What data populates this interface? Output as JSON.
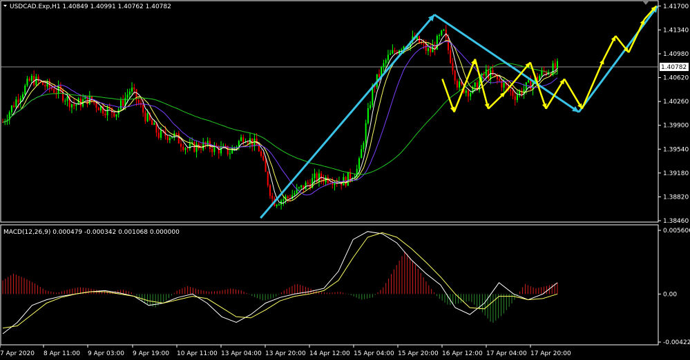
{
  "header": {
    "symbol_line": "USDCAD.Exp,H1  1.40849 1.40991 1.40762 1.40782",
    "macd_line": "MACD(12,26,9) 0.000479 -0.000342 0.001068 0.000000"
  },
  "colors": {
    "background": "#000000",
    "bull": "#00ff00",
    "bear": "#ff0000",
    "ma_fast": "#ffffff",
    "ma_mid": "#ffff66",
    "ma_slow": "#7b3fff",
    "ma_long": "#22cc22",
    "arrow_cyan": "#39c3e6",
    "arrow_yellow": "#ffff00",
    "macd_hist_pos": "#d42020",
    "macd_hist_neg": "#2c8a2c"
  },
  "chart_data": [
    {
      "type": "candlestick",
      "symbol": "USDCAD.Exp",
      "timeframe": "H1",
      "ylim": [
        1.3846,
        1.4175
      ],
      "y_ticks": [
        "1.41700",
        "1.41340",
        "1.40980",
        "1.40620",
        "1.40260",
        "1.39900",
        "1.39540",
        "1.39180",
        "1.38820",
        "1.38460"
      ],
      "current_price": "1.40782",
      "x_ticks": [
        "7 Apr 2020",
        "8 Apr 11:00",
        "9 Apr 03:00",
        "9 Apr 19:00",
        "10 Apr 11:00",
        "13 Apr 04:00",
        "13 Apr 20:00",
        "14 Apr 12:00",
        "15 Apr 04:00",
        "15 Apr 20:00",
        "16 Apr 12:00",
        "17 Apr 04:00",
        "17 Apr 20:00"
      ],
      "price_path": [
        1.3995,
        1.403,
        1.406,
        1.405,
        1.404,
        1.402,
        1.403,
        1.4015,
        1.401,
        1.4045,
        1.4005,
        1.3975,
        1.3975,
        1.3955,
        1.396,
        1.3955,
        1.395,
        1.3975,
        1.3955,
        1.3875,
        1.388,
        1.3895,
        1.391,
        1.391,
        1.3905,
        1.3925,
        1.4045,
        1.409,
        1.411,
        1.412,
        1.41,
        1.413,
        1.405,
        1.404,
        1.407,
        1.4055,
        1.4035,
        1.405,
        1.407,
        1.4078
      ],
      "cyan_arrows": [
        [
          [
            1.385,
            0.395
          ],
          [
            1.4157,
            0.66
          ]
        ],
        [
          [
            1.4157,
            0.66
          ],
          [
            1.401,
            0.88
          ]
        ],
        [
          [
            1.401,
            0.88
          ],
          [
            1.417,
            1.0
          ]
        ]
      ],
      "yellow_path": [
        [
          0.672,
          1.406
        ],
        [
          0.69,
          1.401
        ],
        [
          0.722,
          1.409
        ],
        [
          0.742,
          1.4015
        ],
        [
          0.768,
          1.404
        ],
        [
          0.806,
          1.4085
        ],
        [
          0.83,
          1.4015
        ],
        [
          0.858,
          1.406
        ],
        [
          0.885,
          1.4015
        ],
        [
          0.918,
          1.409
        ],
        [
          0.936,
          1.4125
        ],
        [
          0.956,
          1.41
        ],
        [
          0.98,
          1.415
        ],
        [
          0.998,
          1.417
        ]
      ]
    },
    {
      "type": "histogram",
      "name": "MACD(12,26,9)",
      "ylim": [
        -0.004229,
        0.005606
      ],
      "y_ticks": [
        "0.005606",
        "0.00",
        "-0.004229"
      ],
      "hist": [
        0.0012,
        0.0018,
        0.0014,
        0.0009,
        0.0003,
        0.0001,
        0.0004,
        0.0006,
        0.0005,
        0.0003,
        0.0002,
        0.0004,
        0.0001,
        -0.0008,
        -0.0012,
        -0.0006,
        0.0003,
        0.0007,
        0.0004,
        0.0002,
        0.0003,
        0.0005,
        0.0003,
        -0.0002,
        -0.0006,
        -0.0003,
        0.0004,
        0.0009,
        0.0006,
        0.0002,
        0.0001,
        0.0002,
        -0.0001,
        -0.0005,
        -0.0003,
        0.0006,
        0.0022,
        0.0038,
        0.0025,
        0.001,
        -0.0003,
        -0.001,
        -0.0008,
        -0.0006,
        -0.0015,
        -0.0026,
        -0.0018,
        -0.0006,
        0.0009,
        0.0005,
        0.0007,
        0.001
      ],
      "macd_line": [
        -0.0035,
        -0.0025,
        -0.001,
        -0.0005,
        -0.0002,
        0.0,
        0.0002,
        0.0003,
        0.0001,
        -0.0002,
        -0.001,
        -0.0008,
        -0.0003,
        0.0,
        -0.0008,
        -0.002,
        -0.0025,
        -0.0018,
        -0.0008,
        -0.0003,
        0.0,
        0.0002,
        0.0005,
        0.002,
        0.0048,
        0.0055,
        0.0053,
        0.0045,
        0.003,
        0.0018,
        0.0008,
        -0.0012,
        -0.0018,
        -0.0008,
        0.001,
        0.0,
        -0.0005,
        0.0,
        0.001
      ],
      "signal_line": [
        -0.003,
        -0.0028,
        -0.0018,
        -0.0008,
        -0.0003,
        0.0,
        0.0002,
        0.0002,
        0.0,
        -0.0002,
        -0.0006,
        -0.0008,
        -0.0005,
        -0.0002,
        -0.0004,
        -0.0012,
        -0.002,
        -0.0021,
        -0.0014,
        -0.0006,
        -0.0002,
        0.0,
        0.0003,
        0.0012,
        0.0032,
        0.005,
        0.0054,
        0.005,
        0.004,
        0.0028,
        0.0015,
        0.0,
        -0.0012,
        -0.0013,
        -0.0002,
        -0.0002,
        -0.0005,
        -0.0004,
        0.0
      ]
    }
  ]
}
